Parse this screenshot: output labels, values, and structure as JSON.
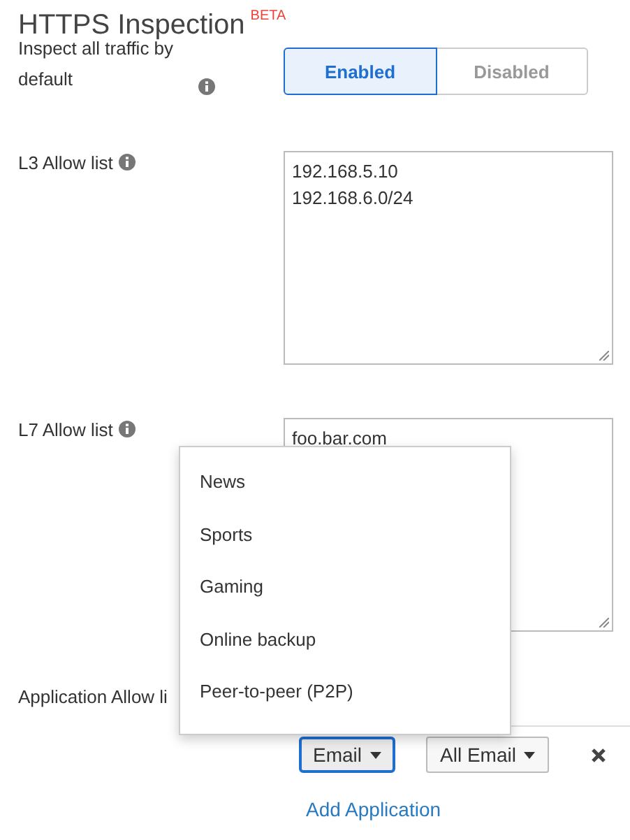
{
  "title": "HTTPS Inspection",
  "badge": "BETA",
  "inspect": {
    "label": "Inspect all traffic by default",
    "options": [
      {
        "label": "Enabled",
        "selected": true
      },
      {
        "label": "Disabled",
        "selected": false
      }
    ]
  },
  "l3": {
    "label": "L3 Allow list",
    "value": "192.168.5.10\n192.168.6.0/24"
  },
  "l7": {
    "label": "L7 Allow list",
    "value": "foo.bar.com"
  },
  "application": {
    "label": "Application Allow li",
    "rules": [
      {
        "category": "Email",
        "application": "All Email",
        "focused": true
      }
    ],
    "add_link": "Add Application"
  },
  "menu": {
    "items": [
      "News",
      "Sports",
      "Gaming",
      "Online backup",
      "Peer-to-peer (P2P)"
    ]
  }
}
